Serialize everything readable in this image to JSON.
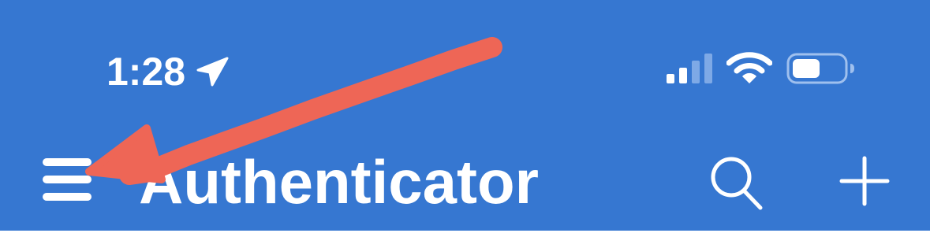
{
  "status_bar": {
    "time": "1:28",
    "location_icon": "location-arrow-icon",
    "signal_icon": "cellular-signal-icon",
    "signal_bars_active": 2,
    "signal_bars_total": 4,
    "wifi_icon": "wifi-icon",
    "battery_icon": "battery-icon",
    "battery_level": 0.45
  },
  "nav_bar": {
    "menu_icon": "hamburger-menu-icon",
    "title": "Authenticator",
    "search_icon": "search-icon",
    "add_icon": "plus-icon"
  },
  "annotation": {
    "type": "arrow",
    "target": "hamburger-menu-icon",
    "color": "#ee6656"
  },
  "colors": {
    "header_background": "#3677d1",
    "foreground": "#ffffff",
    "inactive_signal": "#7ea9e6",
    "annotation": "#ee6656"
  }
}
